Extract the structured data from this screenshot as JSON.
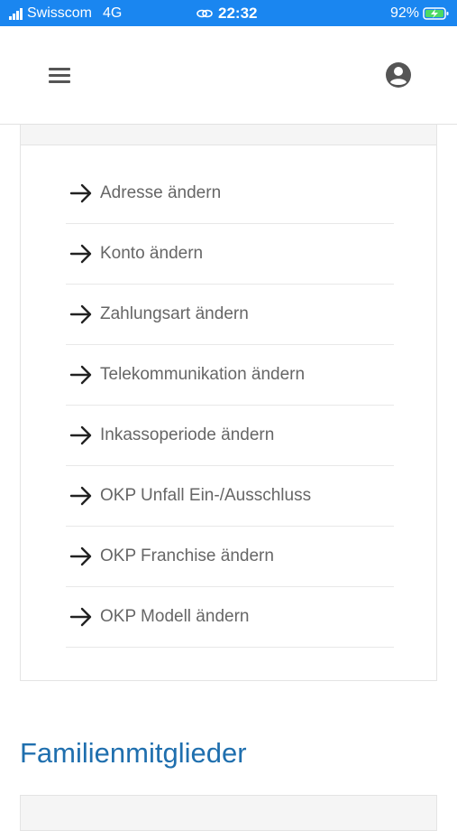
{
  "status_bar": {
    "carrier": "Swisscom",
    "network": "4G",
    "time": "22:32",
    "battery": "92%",
    "bg_color": "#1a86f0"
  },
  "header": {
    "menu_icon": "hamburger-menu-icon",
    "account_icon": "account-circle-icon"
  },
  "actions": [
    {
      "label": "Adresse ändern"
    },
    {
      "label": "Konto ändern"
    },
    {
      "label": "Zahlungsart ändern"
    },
    {
      "label": "Telekommunikation ändern"
    },
    {
      "label": "Inkassoperiode ändern"
    },
    {
      "label": "OKP Unfall Ein-/Ausschluss"
    },
    {
      "label": "OKP Franchise ändern"
    },
    {
      "label": "OKP Modell ändern"
    }
  ],
  "family_section": {
    "title": "Familienmitglieder",
    "title_color": "#1f6fae"
  }
}
